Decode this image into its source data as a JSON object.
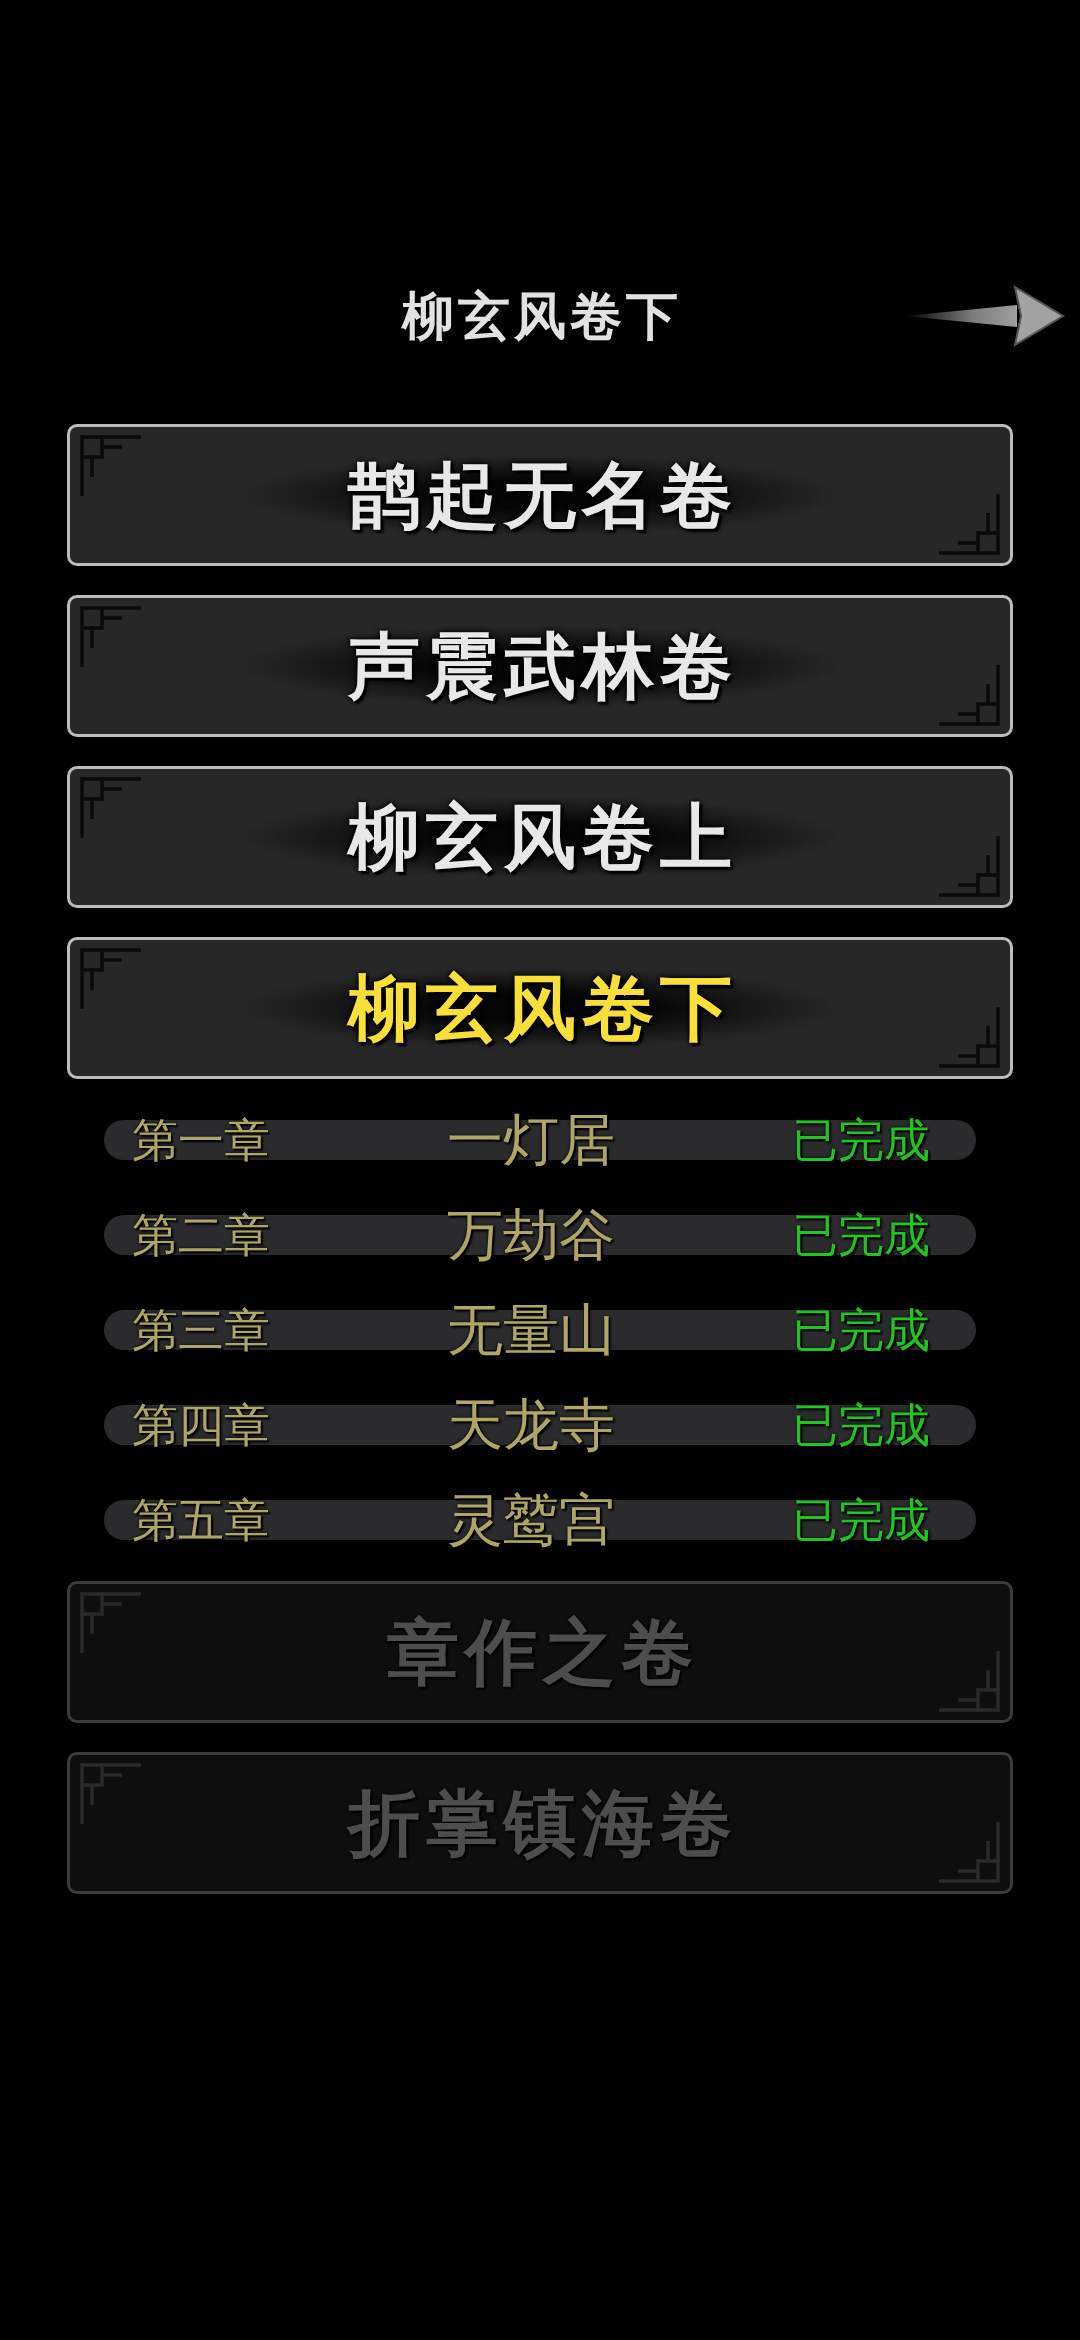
{
  "header": {
    "title": "柳玄风卷下"
  },
  "volumes": [
    {
      "label": "鹊起无名卷",
      "selected": false,
      "disabled": false
    },
    {
      "label": "声震武林卷",
      "selected": false,
      "disabled": false
    },
    {
      "label": "柳玄风卷上",
      "selected": false,
      "disabled": false
    },
    {
      "label": "柳玄风卷下",
      "selected": true,
      "disabled": false,
      "chapters": [
        {
          "number": "第一章",
          "name": "一灯居",
          "status": "已完成",
          "completed": true
        },
        {
          "number": "第二章",
          "name": "万劫谷",
          "status": "已完成",
          "completed": true
        },
        {
          "number": "第三章",
          "name": "无量山",
          "status": "已完成",
          "completed": true
        },
        {
          "number": "第四章",
          "name": "天龙寺",
          "status": "已完成",
          "completed": true
        },
        {
          "number": "第五章",
          "name": "灵鹫宫",
          "status": "已完成",
          "completed": true
        }
      ]
    },
    {
      "label": "章作之卷",
      "selected": false,
      "disabled": true
    },
    {
      "label": "折掌镇海卷",
      "selected": false,
      "disabled": true
    }
  ]
}
